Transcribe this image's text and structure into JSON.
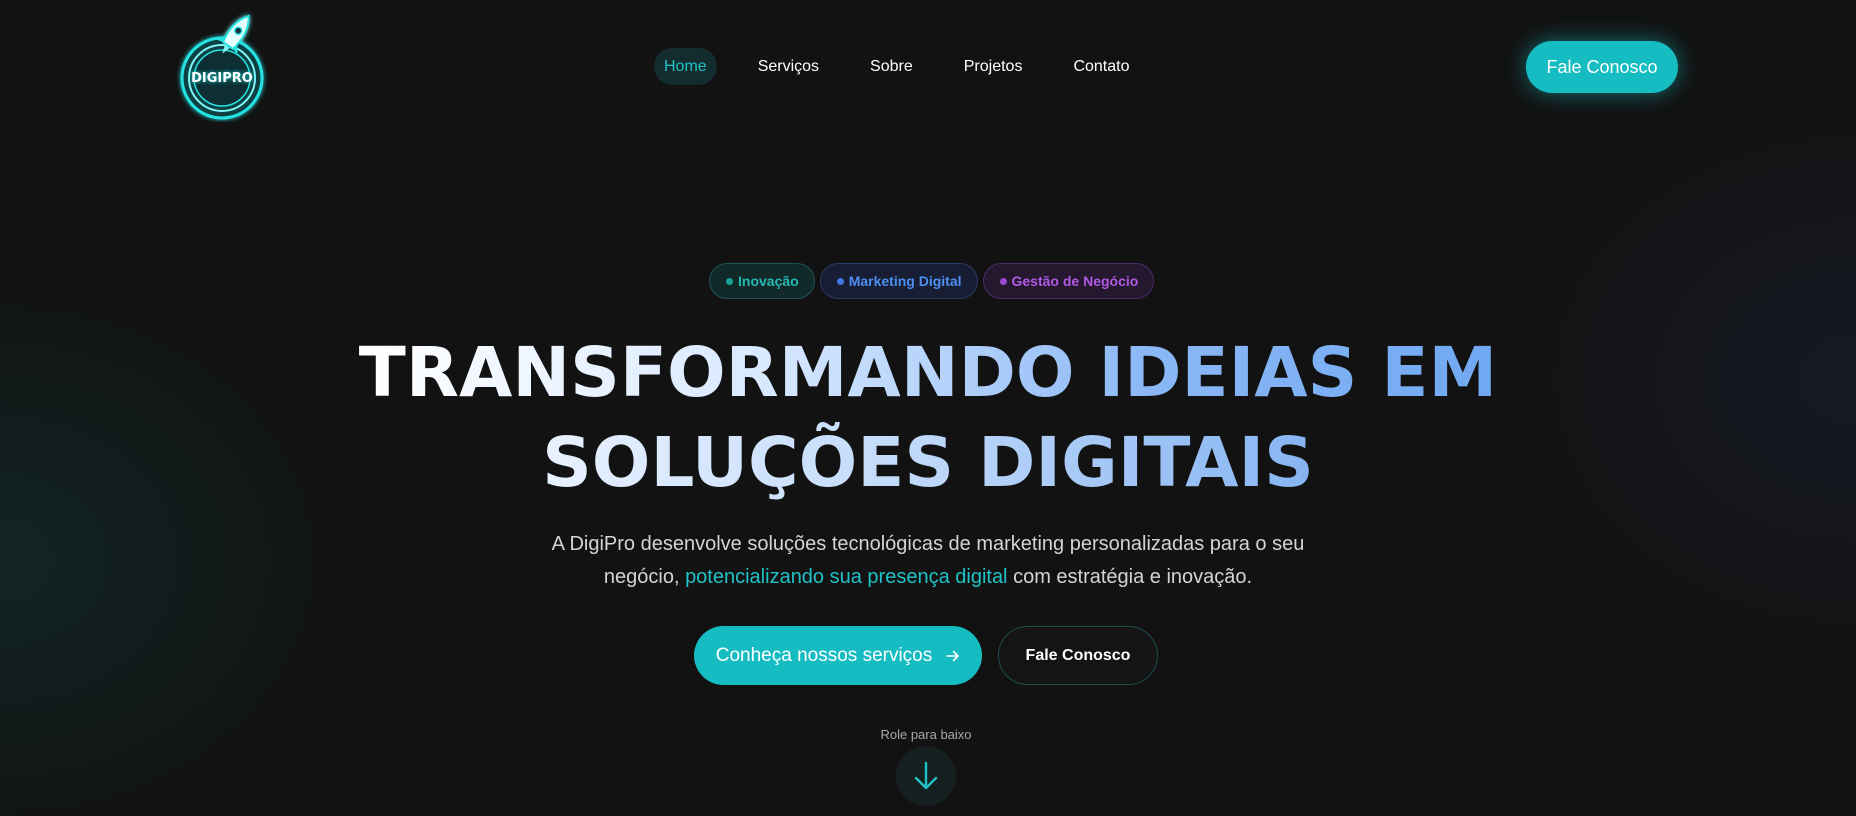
{
  "brand": {
    "logo_text": "DIGIPRO",
    "accent_color": "#15bcc2"
  },
  "nav": {
    "items": [
      {
        "label": "Home",
        "active": true
      },
      {
        "label": "Serviços",
        "active": false
      },
      {
        "label": "Sobre",
        "active": false
      },
      {
        "label": "Projetos",
        "active": false
      },
      {
        "label": "Contato",
        "active": false
      }
    ],
    "cta_label": "Fale Conosco"
  },
  "hero": {
    "tags": [
      {
        "label": "Inovação",
        "color": "#25b9b2"
      },
      {
        "label": "Marketing Digital",
        "color": "#4d8ef2"
      },
      {
        "label": "Gestão de Negócio",
        "color": "#b35ae6"
      }
    ],
    "headline_line1": "TRANSFORMANDO IDEIAS EM",
    "headline_line2": "SOLUÇÕES DIGITAIS",
    "description_part1": "A DigiPro desenvolve soluções tecnológicas de marketing personalizadas para o seu negócio, ",
    "description_highlight": "potencializando sua presença digital",
    "description_part2": " com estratégia e inovação.",
    "primary_button_label": "Conheça nossos serviços",
    "primary_button_icon": "arrow-right-icon",
    "secondary_button_label": "Fale Conosco",
    "scroll_label": "Role para baixo",
    "scroll_icon": "arrow-down-icon"
  }
}
